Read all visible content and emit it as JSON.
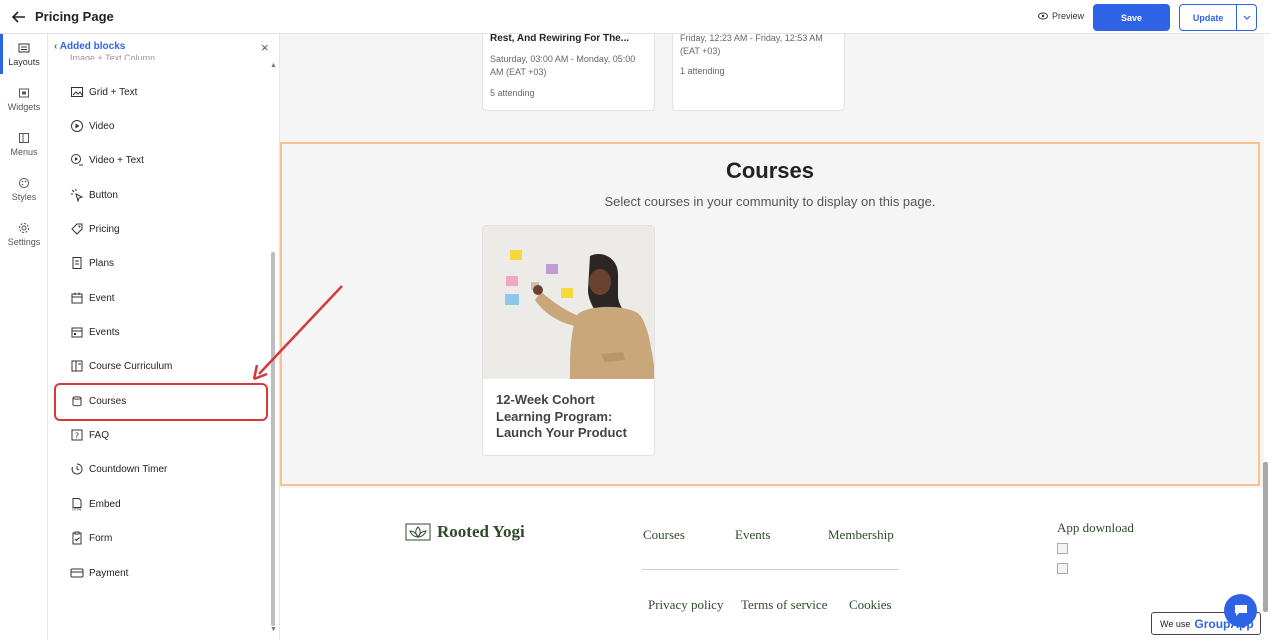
{
  "topbar": {
    "title": "Pricing Page",
    "preview_label": "Preview",
    "save_label": "Save",
    "update_label": "Update"
  },
  "rail": {
    "items": [
      {
        "label": "Layouts",
        "icon": "layouts-icon"
      },
      {
        "label": "Widgets",
        "icon": "widgets-icon"
      },
      {
        "label": "Menus",
        "icon": "menus-icon"
      },
      {
        "label": "Styles",
        "icon": "styles-icon"
      },
      {
        "label": "Settings",
        "icon": "settings-icon"
      }
    ],
    "active": "Layouts"
  },
  "panel": {
    "header": "Added blocks",
    "clipped_item": "Image + Text Column",
    "items": [
      {
        "label": "Grid + Text",
        "icon": "grid-text-icon"
      },
      {
        "label": "Video",
        "icon": "video-icon"
      },
      {
        "label": "Video + Text",
        "icon": "video-text-icon"
      },
      {
        "label": "Button",
        "icon": "button-icon"
      },
      {
        "label": "Pricing",
        "icon": "pricing-icon"
      },
      {
        "label": "Plans",
        "icon": "plans-icon"
      },
      {
        "label": "Event",
        "icon": "event-icon"
      },
      {
        "label": "Events",
        "icon": "events-icon"
      },
      {
        "label": "Course Curriculum",
        "icon": "course-curriculum-icon"
      },
      {
        "label": "Courses",
        "icon": "courses-icon"
      },
      {
        "label": "FAQ",
        "icon": "faq-icon"
      },
      {
        "label": "Countdown Timer",
        "icon": "countdown-timer-icon"
      },
      {
        "label": "Embed",
        "icon": "embed-icon"
      },
      {
        "label": "Form",
        "icon": "form-icon"
      },
      {
        "label": "Payment",
        "icon": "payment-icon"
      }
    ],
    "highlighted": "Courses"
  },
  "events": [
    {
      "title": "Rest, And Rewiring For The...",
      "date": "Saturday, 03:00 AM - Monday, 05:00 AM (EAT +03)",
      "attending": "5 attending"
    },
    {
      "title": "",
      "date": "Friday, 12:23 AM - Friday, 12:53 AM (EAT +03)",
      "attending": "1 attending"
    }
  ],
  "courses_section": {
    "title": "Courses",
    "subtitle": "Select courses in your community to display on this page.",
    "course": {
      "name": "12-Week Cohort Learning Program: Launch Your Product"
    }
  },
  "footer": {
    "brand": "Rooted Yogi",
    "links": [
      "Courses",
      "Events",
      "Membership"
    ],
    "legal": [
      "Privacy policy",
      "Terms of service",
      "Cookies"
    ],
    "app_download": "App download"
  },
  "widget": {
    "we_use": "We use",
    "brand": "GroupApp"
  },
  "colors": {
    "accent": "#2f63e6",
    "highlight": "#d33a3a",
    "section_border": "#f6c38d",
    "footer_text": "#2f4a2c"
  }
}
